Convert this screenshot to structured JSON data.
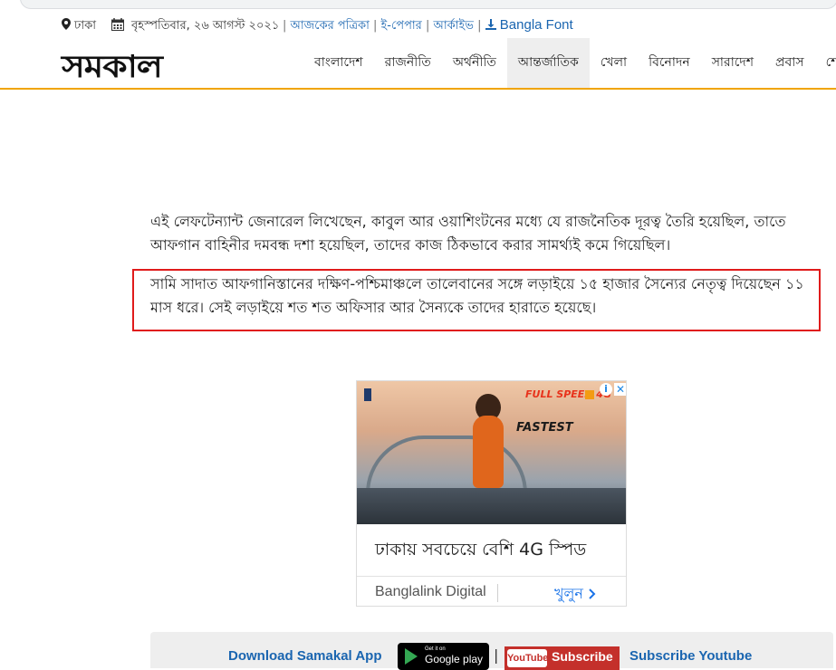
{
  "topbar": {
    "location": "ঢাকা",
    "date": "বৃহস্পতিবার, ২৬ আগস্ট ২০২১",
    "links": [
      "আজকের পত্রিকা",
      "ই-পেপার",
      "আর্কাইভ"
    ],
    "font_link": "Bangla Font"
  },
  "header": {
    "logo": "সমকাল",
    "nav": [
      "বাংলাদেশ",
      "রাজনীতি",
      "অর্থনীতি",
      "আন্তর্জাতিক",
      "খেলা",
      "বিনোদন",
      "সারাদেশ",
      "প্রবাস",
      "শেয়া"
    ],
    "active_nav": "আন্তর্জাতিক"
  },
  "article": {
    "paragraph1": "এই লেফটেন্যান্ট জেনারেল লিখেছেন, কাবুল আর ওয়াশিংটনের মধ্যে যে রাজনৈতিক দূরত্ব তৈরি হয়েছিল, তাতে আফগান বাহিনীর দমবন্ধ দশা হয়েছিল, তাদের কাজ ঠিকভাবে করার সামর্থ্যই কমে গিয়েছিল।",
    "paragraph2": "সামি সাদাত আফগানিস্তানের দক্ষিণ-পশ্চিমাঞ্চলে তালেবানের সঙ্গে লড়াইয়ে ১৫ হাজার সৈন্যের নেতৃত্ব দিয়েছেন ১১ মাস ধরে। সেই লড়াইয়ে শত শত অফিসার আর সৈন্যকে তাদের হারাতে হয়েছে।",
    "highlight_color": "#e01b1b"
  },
  "ad": {
    "brand_tag": "FULL SPEED 4G",
    "image_text": "FASTEST",
    "headline": "ঢাকায় সবচেয়ে বেশি 4G স্পিড",
    "advertiser": "Banglalink Digital",
    "cta": "খুলুন",
    "info_icon": "i",
    "close_icon": "✕"
  },
  "appbar": {
    "download_text": "Download Samakal App",
    "gplay_small": "Get it on",
    "gplay_big": "Google play",
    "separator": "|",
    "yt_logo": "YouTube",
    "yt_subscribe": "Subscribe",
    "subscribe_youtube": "Subscribe Youtube"
  },
  "colors": {
    "accent": "#f0a400",
    "link": "#1a65b0",
    "ad_cta": "#1a73e8"
  }
}
